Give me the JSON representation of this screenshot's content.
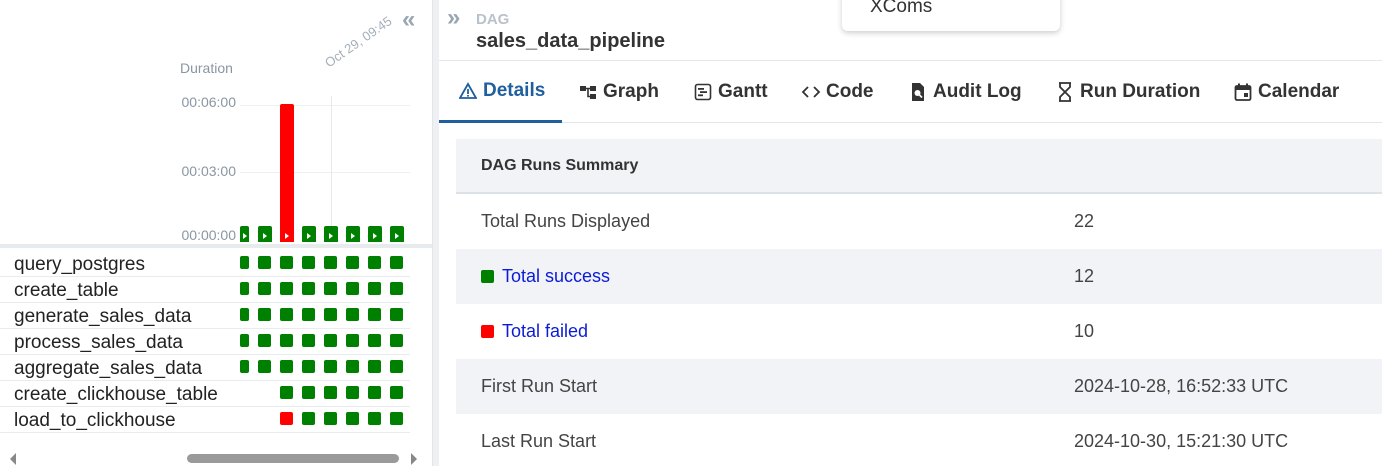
{
  "left_panel": {
    "collapse_icon": "double-chevron-left-icon",
    "duration_label": "Duration",
    "y_ticks": [
      "00:06:00",
      "00:03:00",
      "00:00:00"
    ],
    "date_label": "Oct 29, 09:45"
  },
  "chart_data": {
    "type": "bar",
    "title": "",
    "ylabel": "Duration",
    "y_unit": "seconds",
    "ylim": [
      0,
      360
    ],
    "y_tick_labels": [
      "00:00:00",
      "00:03:00",
      "00:06:00"
    ],
    "runs": [
      {
        "state": "success",
        "seconds": 18
      },
      {
        "state": "success",
        "seconds": 18
      },
      {
        "state": "failed",
        "seconds": 360
      },
      {
        "state": "success",
        "seconds": 18
      },
      {
        "state": "success",
        "seconds": 24
      },
      {
        "state": "success",
        "seconds": 20
      },
      {
        "state": "success",
        "seconds": 18
      },
      {
        "state": "success",
        "seconds": 18
      }
    ],
    "annotation": "Oct 29, 09:45"
  },
  "tasks": [
    {
      "name": "query_postgres",
      "states": [
        "success",
        "success",
        "success",
        "success",
        "success",
        "success",
        "success",
        "success"
      ]
    },
    {
      "name": "create_table",
      "states": [
        "success",
        "success",
        "success",
        "success",
        "success",
        "success",
        "success",
        "success"
      ]
    },
    {
      "name": "generate_sales_data",
      "states": [
        "success",
        "success",
        "success",
        "success",
        "success",
        "success",
        "success",
        "success"
      ]
    },
    {
      "name": "process_sales_data",
      "states": [
        "success",
        "success",
        "success",
        "success",
        "success",
        "success",
        "success",
        "success"
      ]
    },
    {
      "name": "aggregate_sales_data",
      "states": [
        "success",
        "success",
        "success",
        "success",
        "success",
        "success",
        "success",
        "success"
      ]
    },
    {
      "name": "create_clickhouse_table",
      "states": [
        "none",
        "none",
        "success",
        "success",
        "success",
        "success",
        "success",
        "success"
      ]
    },
    {
      "name": "load_to_clickhouse",
      "states": [
        "none",
        "none",
        "failed",
        "success",
        "success",
        "success",
        "success",
        "success"
      ]
    }
  ],
  "colors": {
    "success": "#008000",
    "failed": "#ff0000",
    "accent": "#1f5f9d",
    "link": "#0b1bd6"
  },
  "header": {
    "expand_icon": "double-chevron-right-icon",
    "label": "DAG",
    "title": "sales_data_pipeline",
    "dropdown_item": "XComs"
  },
  "tabs": [
    {
      "label": "Details",
      "icon": "warning-triangle-icon",
      "active": true
    },
    {
      "label": "Graph",
      "icon": "graph-icon",
      "active": false
    },
    {
      "label": "Gantt",
      "icon": "gantt-icon",
      "active": false
    },
    {
      "label": "Code",
      "icon": "code-icon",
      "active": false
    },
    {
      "label": "Audit Log",
      "icon": "audit-log-icon",
      "active": false
    },
    {
      "label": "Run Duration",
      "icon": "hourglass-icon",
      "active": false
    },
    {
      "label": "Calendar",
      "icon": "calendar-icon",
      "active": false
    }
  ],
  "summary": {
    "heading": "DAG Runs Summary",
    "rows": [
      {
        "key": "Total Runs Displayed",
        "value": "22"
      },
      {
        "key": "Total success",
        "value": "12",
        "status": "success"
      },
      {
        "key": "Total failed",
        "value": "10",
        "status": "failed"
      },
      {
        "key": "First Run Start",
        "value": "2024-10-28, 16:52:33 UTC"
      },
      {
        "key": "Last Run Start",
        "value": "2024-10-30, 15:21:30 UTC"
      }
    ]
  }
}
